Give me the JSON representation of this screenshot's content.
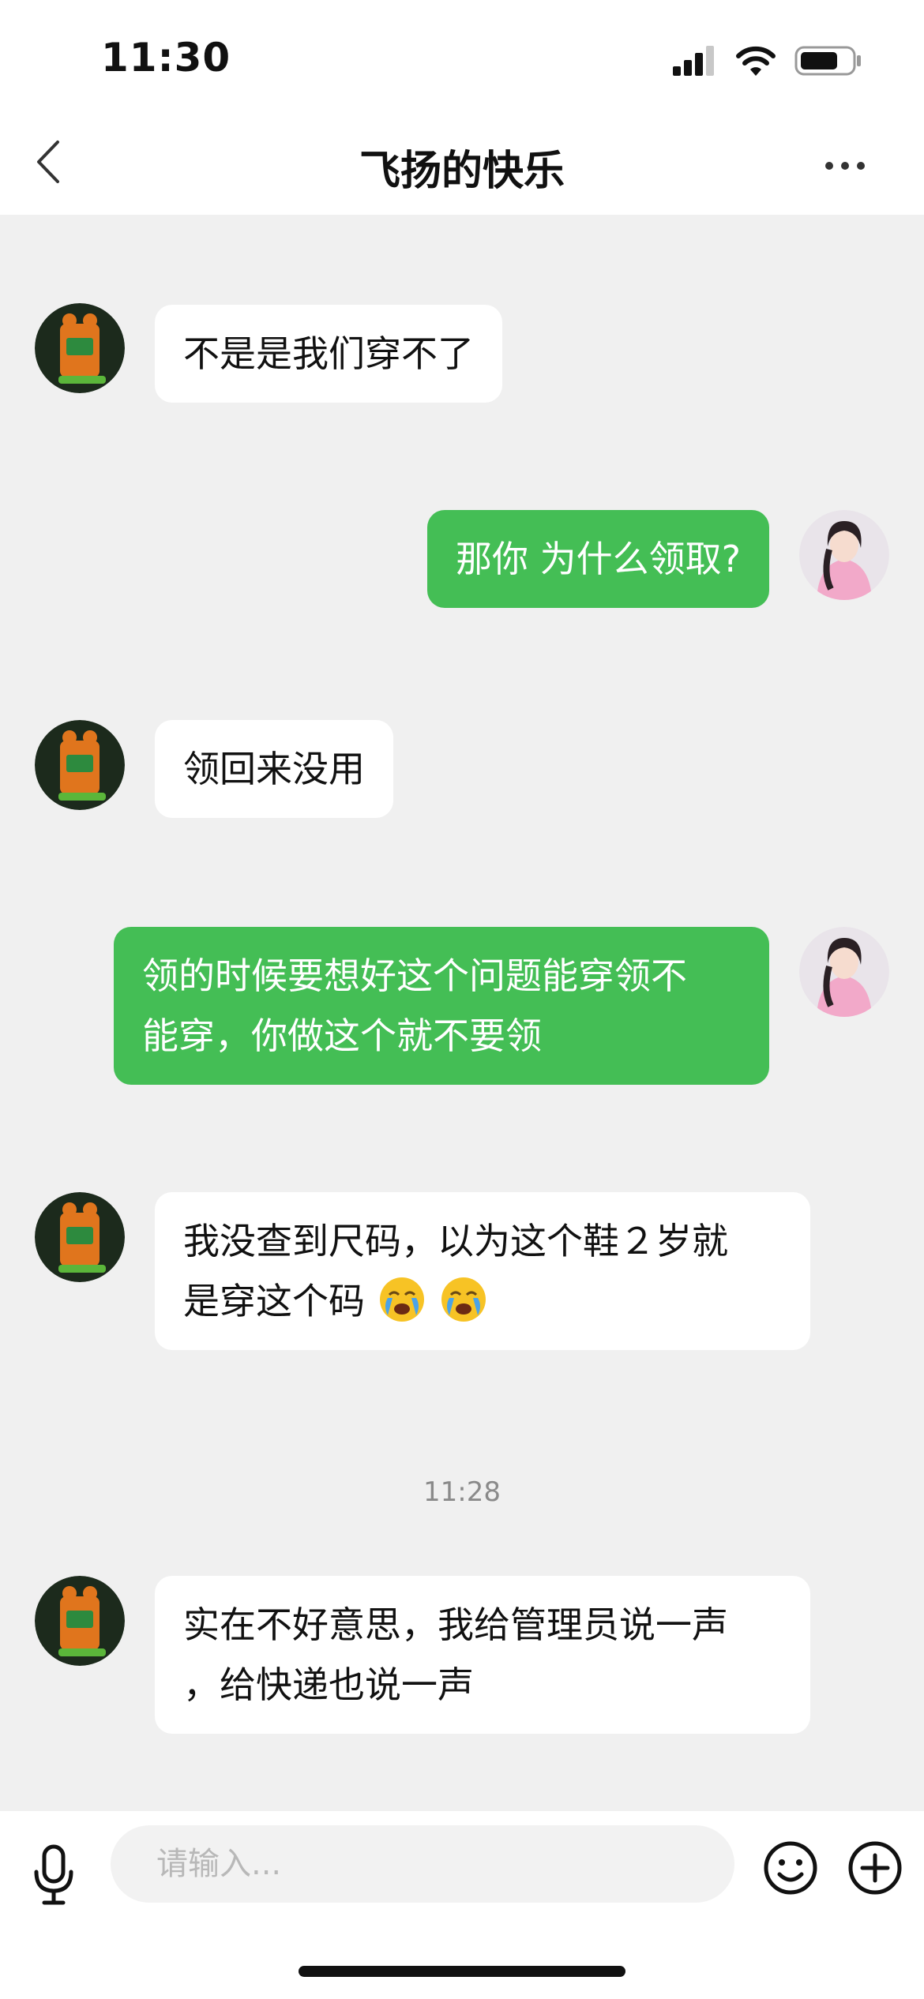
{
  "status": {
    "time": "11:30"
  },
  "nav": {
    "title": "飞扬的快乐"
  },
  "messages": [
    {
      "side": "left",
      "lines": [
        "不是是我们穿不了"
      ]
    },
    {
      "side": "right",
      "lines": [
        "那你 为什么领取?"
      ]
    },
    {
      "side": "left",
      "lines": [
        "领回来没用"
      ]
    },
    {
      "side": "right",
      "lines": [
        "领的时候要想好这个问题能穿领不",
        "能穿，你做这个就不要领"
      ]
    },
    {
      "side": "left",
      "lines": [
        "我没查到尺码，以为这个鞋２岁就",
        "是穿这个码"
      ],
      "emojis": [
        "😭",
        "😭"
      ]
    },
    {
      "side": "left",
      "lines": [
        "实在不好意思，我给管理员说一声",
        "，给快递也说一声"
      ]
    }
  ],
  "timestamp": "11:28",
  "input": {
    "placeholder": "请输入..."
  },
  "colors": {
    "outgoing_bubble": "#44be55",
    "incoming_bubble": "#ffffff",
    "background": "#f0f0f0"
  },
  "icons": {
    "back": "chevron-left-icon",
    "more": "more-dots-icon",
    "mic": "microphone-icon",
    "emoji": "smiley-icon",
    "add": "plus-circle-icon"
  }
}
